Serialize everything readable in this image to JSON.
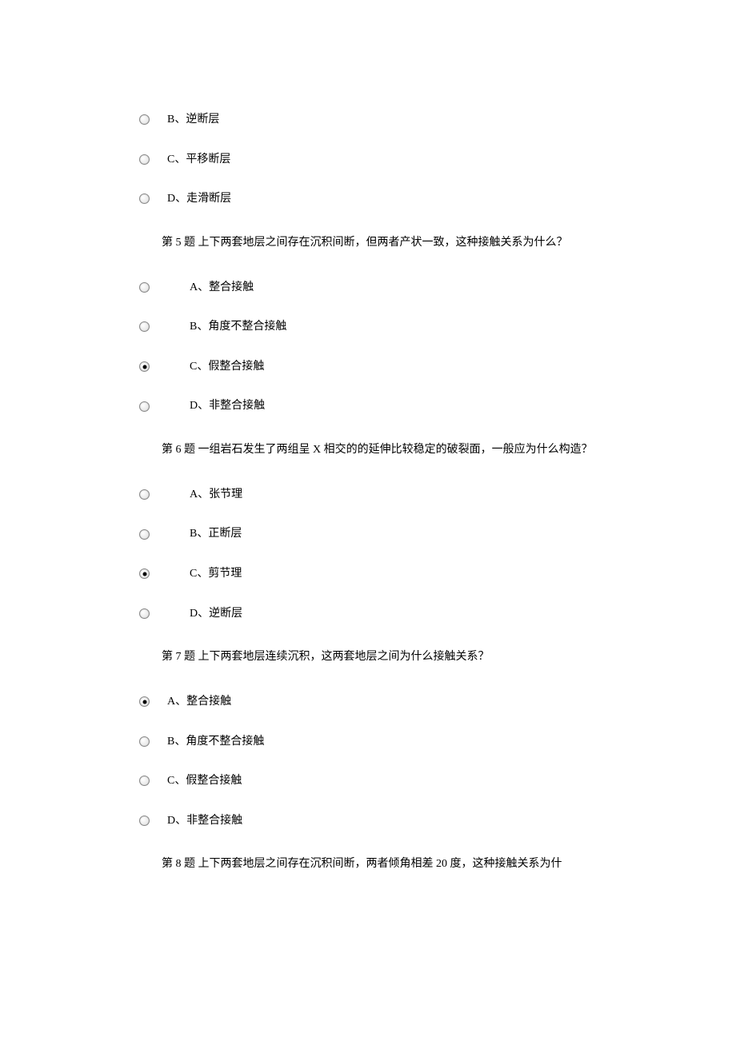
{
  "questions": [
    {
      "prompt": "",
      "options": [
        {
          "label": "B、逆断层",
          "selected": false,
          "indent": false
        },
        {
          "label": "C、平移断层",
          "selected": false,
          "indent": false
        },
        {
          "label": "D、走滑断层",
          "selected": false,
          "indent": false
        }
      ]
    },
    {
      "prompt": "第 5 题  上下两套地层之间存在沉积间断，但两者产状一致，这种接触关系为什么？",
      "options": [
        {
          "label": "A、整合接触",
          "selected": false,
          "indent": true
        },
        {
          "label": "B、角度不整合接触",
          "selected": false,
          "indent": true
        },
        {
          "label": "C、假整合接触",
          "selected": true,
          "indent": true
        },
        {
          "label": "D、非整合接触",
          "selected": false,
          "indent": true
        }
      ]
    },
    {
      "prompt": "第 6 题  一组岩石发生了两组呈 X 相交的的延伸比较稳定的破裂面，一般应为什么构造？",
      "options": [
        {
          "label": "A、张节理",
          "selected": false,
          "indent": true
        },
        {
          "label": "B、正断层",
          "selected": false,
          "indent": true
        },
        {
          "label": "C、剪节理",
          "selected": true,
          "indent": true
        },
        {
          "label": "D、逆断层",
          "selected": false,
          "indent": true
        }
      ]
    },
    {
      "prompt": "第 7 题  上下两套地层连续沉积，这两套地层之间为什么接触关系？",
      "options": [
        {
          "label": "A、整合接触",
          "selected": true,
          "indent": false
        },
        {
          "label": "B、角度不整合接触",
          "selected": false,
          "indent": false
        },
        {
          "label": "C、假整合接触",
          "selected": false,
          "indent": false
        },
        {
          "label": "D、非整合接触",
          "selected": false,
          "indent": false
        }
      ]
    }
  ],
  "lastPrompt": "第 8 题  上下两套地层之间存在沉积间断，两者倾角相差 20 度，这种接触关系为什"
}
